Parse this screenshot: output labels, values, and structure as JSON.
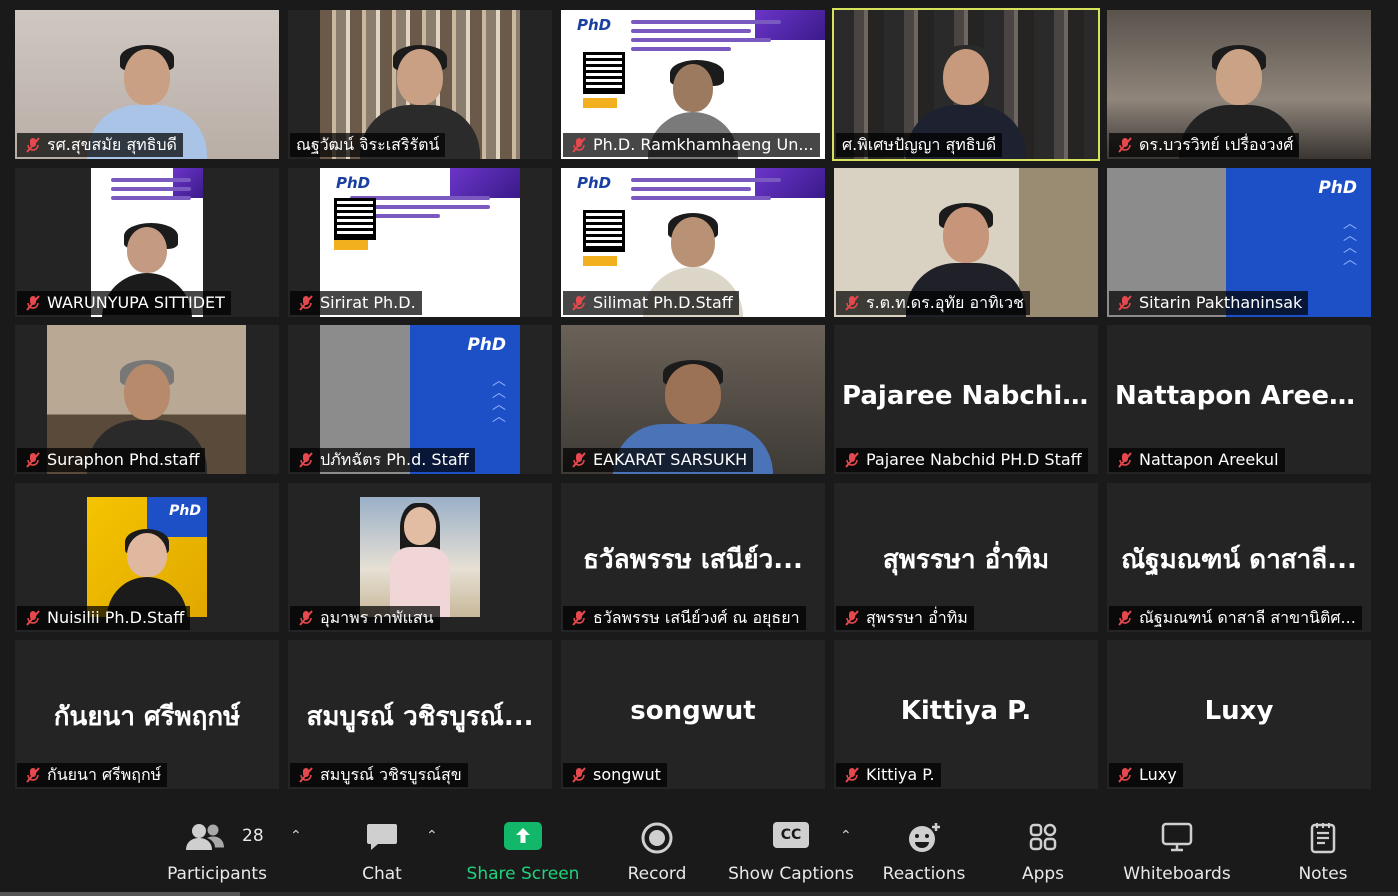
{
  "participants": [
    {
      "name": "รศ.สุขสมัย สุทธิบดี"
    },
    {
      "name": "ณฐวัฒน์ จิระเสริรัตน์"
    },
    {
      "name": "Ph.D. Ramkhamhaeng Un..."
    },
    {
      "name": "ศ.พิเศษปัญญา สุทธิบดี"
    },
    {
      "name": "ดร.บวรวิทย์  เปรื่องวงศ์"
    },
    {
      "name": "WARUNYUPA SITTIDET"
    },
    {
      "name": "Sirirat Ph.D."
    },
    {
      "name": "Silimat Ph.D.Staff"
    },
    {
      "name": "ร.ต.ท.ดร.อุทัย  อาทิเวช"
    },
    {
      "name": "Sitarin Pakthaninsak"
    },
    {
      "name": "Suraphon Phd.staff"
    },
    {
      "name": "ปภัทฉัตร Ph.d. Staff"
    },
    {
      "name": "EAKARAT SARSUKH"
    },
    {
      "name": "Pajaree Nabchid PH.D Staff",
      "display": "Pajaree  Nabchi..."
    },
    {
      "name": "Nattapon Areekul",
      "display": "Nattapon Areekul"
    },
    {
      "name": "Nuisilii Ph.D.Staff"
    },
    {
      "name": "อุมาพร กาพัแสน"
    },
    {
      "name": "ธวัลพรรษ เสนีย์วงศ์ ณ อยุธยา",
      "display": "ธวัลพรรษ เสนีย์ว..."
    },
    {
      "name": "สุพรรษา อ่ำทิม",
      "display": "สุพรรษา อ่ำทิม"
    },
    {
      "name": "ณัฐมณฑน์ ดาสาลี สาขานิติศ...",
      "display": "ณัฐมณฑน์ ดาสาลี..."
    },
    {
      "name": "กันยนา ศรีพฤกษ์",
      "display": "กันยนา ศรีพฤกษ์"
    },
    {
      "name": "สมบูรณ์ วชิรบูรณ์สุข",
      "display": "สมบูรณ์ วชิรบูรณ์..."
    },
    {
      "name": "songwut",
      "display": "songwut"
    },
    {
      "name": "Kittiya P.",
      "display": "Kittiya P."
    },
    {
      "name": "Luxy",
      "display": "Luxy"
    }
  ],
  "slide_logo": "PhD",
  "toolbar": {
    "participants_label": "Participants",
    "participants_count": "28",
    "chat_label": "Chat",
    "share_label": "Share Screen",
    "record_label": "Record",
    "captions_label": "Show Captions",
    "captions_icon_text": "CC",
    "reactions_label": "Reactions",
    "apps_label": "Apps",
    "whiteboards_label": "Whiteboards",
    "notes_label": "Notes"
  },
  "colors": {
    "active_speaker_border": "#d6e35a",
    "share_green": "#12b76a",
    "muted_red": "#e5484d"
  }
}
